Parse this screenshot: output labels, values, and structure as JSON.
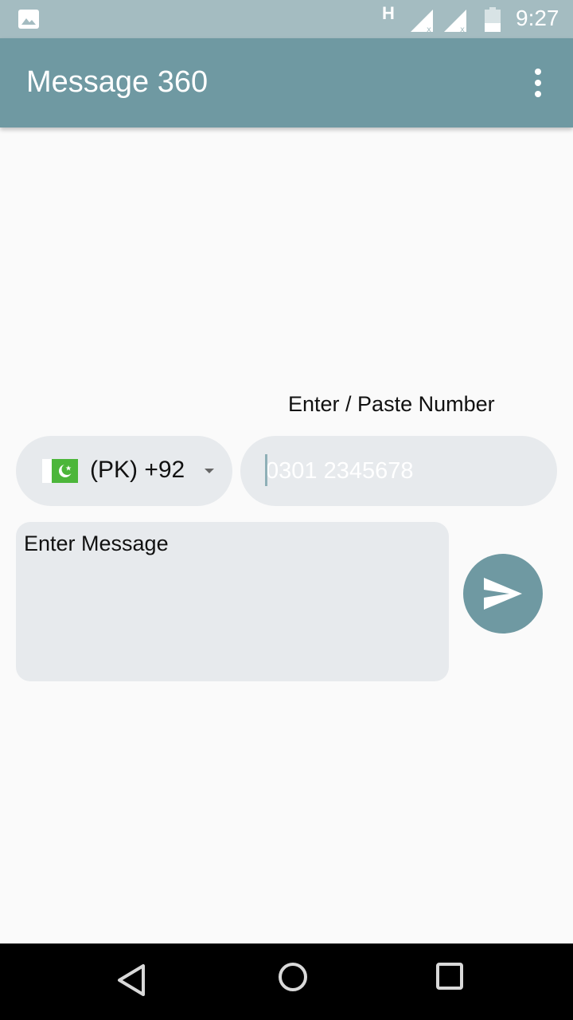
{
  "status_bar": {
    "network_type": "H",
    "time": "9:27",
    "icons": [
      "gallery-icon",
      "signal-icon",
      "signal-icon",
      "battery-icon"
    ]
  },
  "app_bar": {
    "title": "Message 360",
    "menu_icon": "more-vert-icon"
  },
  "form": {
    "number_label": "Enter / Paste Number",
    "country": {
      "flag": "pakistan-flag-icon",
      "code": "(PK) +92"
    },
    "phone": {
      "value": "",
      "placeholder": "0301 2345678"
    },
    "message": {
      "value": "",
      "placeholder": "Enter Message"
    },
    "send_icon": "send-icon"
  },
  "nav_bar": {
    "icons": [
      "back-icon",
      "home-icon",
      "recents-icon"
    ]
  },
  "colors": {
    "status_bar": "#a4bcc1",
    "app_bar": "#6f99a2",
    "field_bg": "#e7eaed",
    "background": "#fafafa",
    "accent": "#6f99a2"
  }
}
